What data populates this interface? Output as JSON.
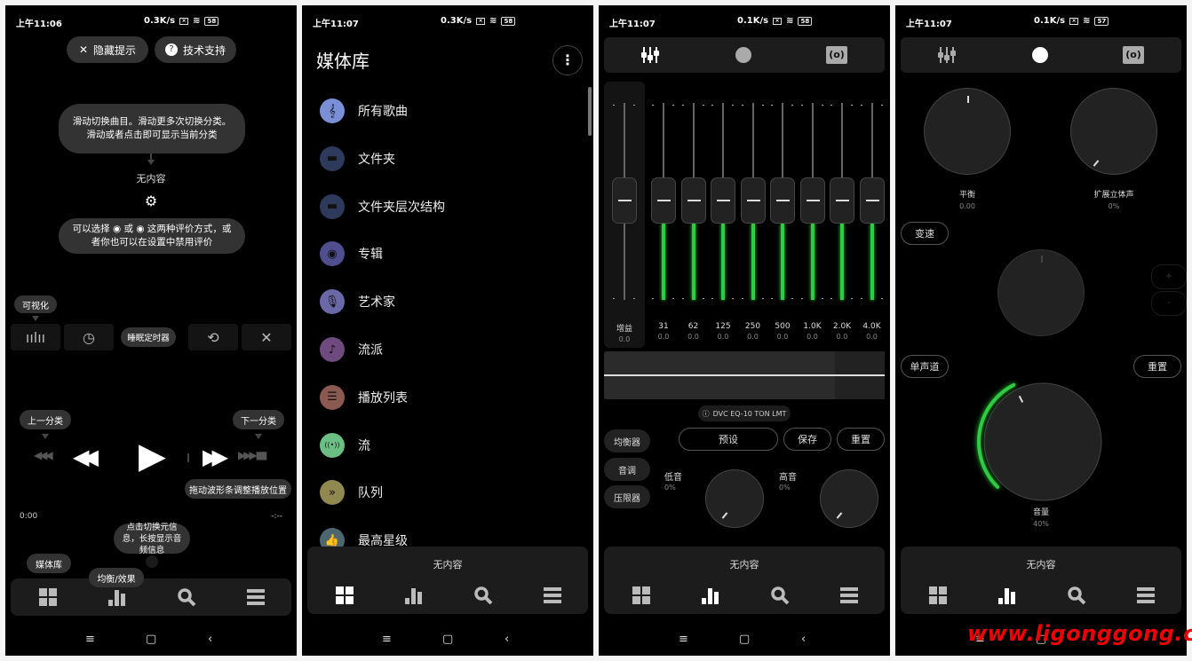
{
  "panels": [
    {
      "status": {
        "time": "上午11:06",
        "speed": "0.3K/s",
        "battery": "58"
      },
      "top_buttons": {
        "hide_hint": "隐藏提示",
        "support": "技术支持"
      },
      "tips": {
        "swipe": "滑动切换曲目。滑动更多次切换分类。滑动或者点击即可显示当前分类",
        "rating": "可以选择 ◉ 或 ◉ 这两种评价方式，或者你也可以在设置中禁用评价",
        "visual": "可视化",
        "sleep_timer": "睡眠定时器",
        "prev_cat": "上一分类",
        "next_cat": "下一分类",
        "drag_wave": "拖动波形条调整播放位置",
        "meta": "点击切换元信息，长按显示音频信息",
        "library": "媒体库",
        "eq": "均衡/效果"
      },
      "no_content": "无内容",
      "time_start": "0:00",
      "time_end": "-:--"
    },
    {
      "status": {
        "time": "上午11:07",
        "speed": "0.3K/s",
        "battery": "58"
      },
      "title": "媒体库",
      "items": [
        {
          "label": "所有歌曲",
          "icon": "treble-clef-icon",
          "color": "#7b8fd6",
          "glyph": "𝄞"
        },
        {
          "label": "文件夹",
          "icon": "folder-icon",
          "color": "#2e3a5c",
          "glyph": "▬"
        },
        {
          "label": "文件夹层次结构",
          "icon": "folder-tree-icon",
          "color": "#2e3a5c",
          "glyph": "▬"
        },
        {
          "label": "专辑",
          "icon": "album-icon",
          "color": "#4f4f8f",
          "glyph": "◉"
        },
        {
          "label": "艺术家",
          "icon": "microphone-icon",
          "color": "#6b68a8",
          "glyph": "🎙"
        },
        {
          "label": "流派",
          "icon": "guitar-icon",
          "color": "#6e4a7e",
          "glyph": "♪"
        },
        {
          "label": "播放列表",
          "icon": "playlist-icon",
          "color": "#8a5a50",
          "glyph": "☰"
        },
        {
          "label": "流",
          "icon": "stream-icon",
          "color": "#6cbf84",
          "glyph": "((•))"
        },
        {
          "label": "队列",
          "icon": "queue-icon",
          "color": "#8f8850",
          "glyph": "»"
        },
        {
          "label": "最高星级",
          "icon": "thumbs-up-icon",
          "color": "#4e6670",
          "glyph": "👍"
        }
      ],
      "no_content": "无内容"
    },
    {
      "status": {
        "time": "上午11:07",
        "speed": "0.1K/s",
        "battery": "58"
      },
      "bands": [
        {
          "label": "增益",
          "value": "0.0"
        },
        {
          "label": "31",
          "value": "0.0"
        },
        {
          "label": "62",
          "value": "0.0"
        },
        {
          "label": "125",
          "value": "0.0"
        },
        {
          "label": "250",
          "value": "0.0"
        },
        {
          "label": "500",
          "value": "0.0"
        },
        {
          "label": "1.0K",
          "value": "0.0"
        },
        {
          "label": "2.0K",
          "value": "0.0"
        },
        {
          "label": "4.0K",
          "value": "0.0"
        }
      ],
      "dvc_label": "DVC EQ-10 TON LMT",
      "side_tabs": [
        "均衡器",
        "音调",
        "压限器"
      ],
      "preset": "预设",
      "save": "保存",
      "reset": "重置",
      "bass": {
        "label": "低音",
        "value": "0%"
      },
      "treble": {
        "label": "高音",
        "value": "0%"
      },
      "no_content": "无内容"
    },
    {
      "status": {
        "time": "上午11:07",
        "speed": "0.1K/s",
        "battery": "57"
      },
      "balance": {
        "label": "平衡",
        "value": "0.00"
      },
      "stereo": {
        "label": "扩展立体声",
        "value": "0%"
      },
      "tempo": "变速",
      "mono": "单声道",
      "reset": "重置",
      "volume": {
        "label": "音量",
        "value": "40%",
        "fraction": 0.4
      },
      "no_content": "无内容"
    }
  ],
  "watermark": "www.ligonggong.com",
  "accent": "#2ecc40"
}
